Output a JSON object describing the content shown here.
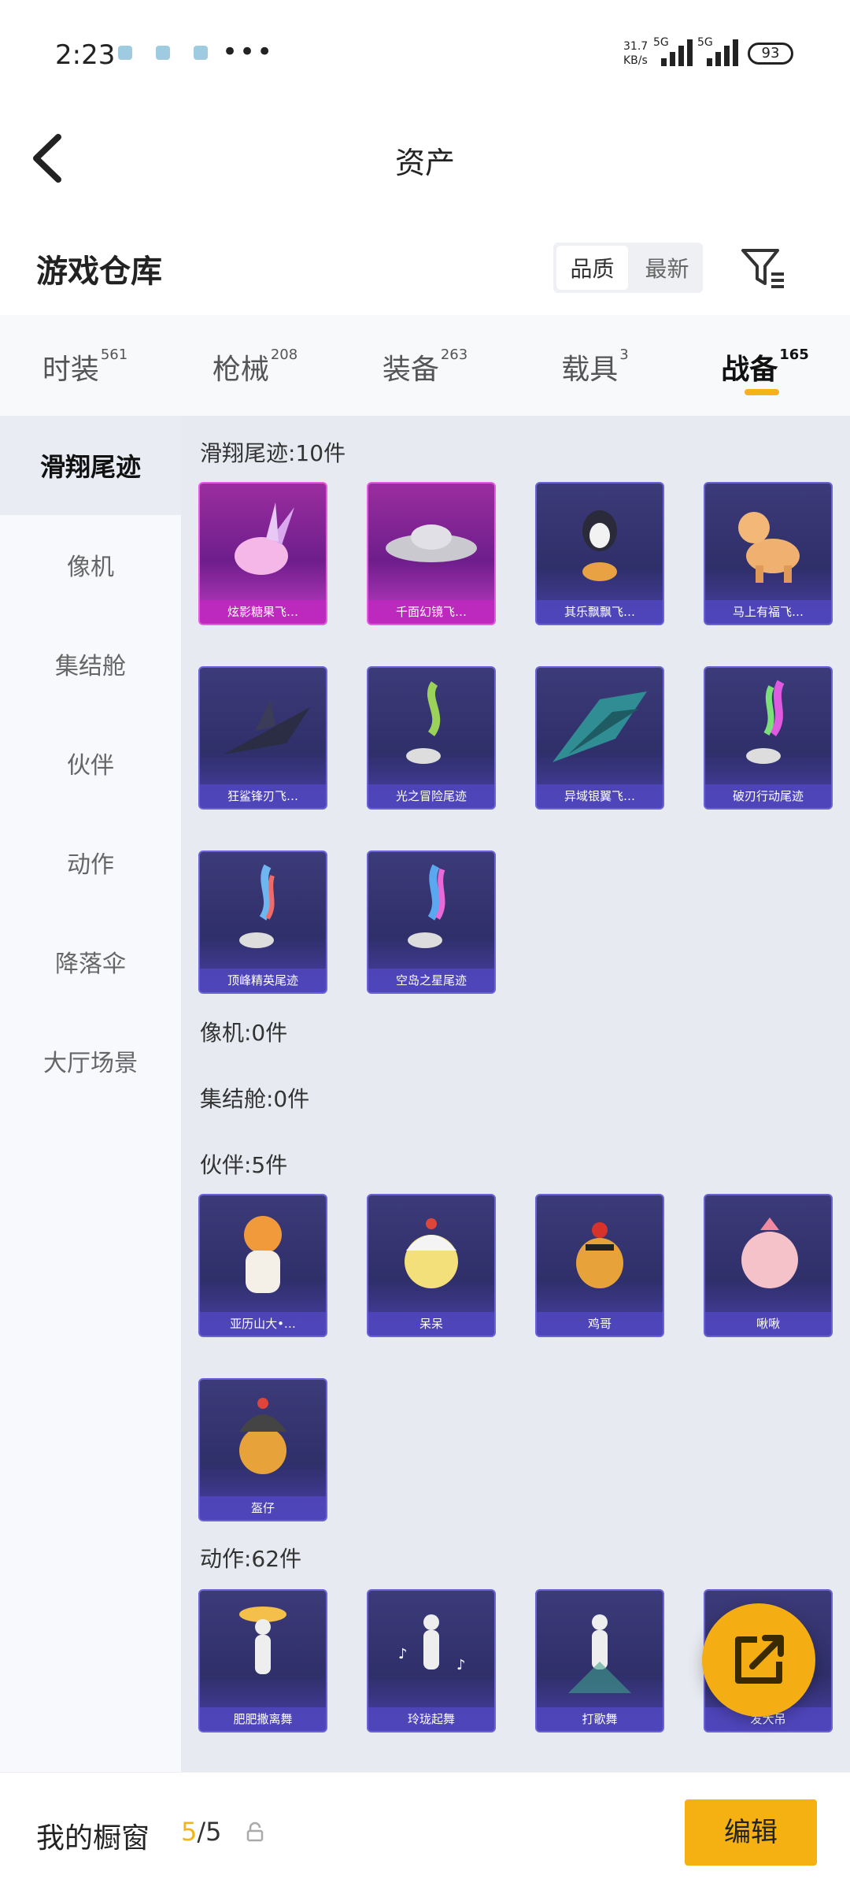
{
  "status": {
    "time": "2:23",
    "more": "•••",
    "net_speed": "31.7",
    "net_unit": "KB/s",
    "sig1": "5G",
    "sig2": "5G",
    "battery": "93"
  },
  "header": {
    "title": "资产"
  },
  "warehouse": {
    "title": "游戏仓库",
    "seg": [
      "品质",
      "最新"
    ]
  },
  "tabs": [
    {
      "label": "时装",
      "count": "561"
    },
    {
      "label": "枪械",
      "count": "208"
    },
    {
      "label": "装备",
      "count": "263"
    },
    {
      "label": "载具",
      "count": "3"
    },
    {
      "label": "战备",
      "count": "165"
    }
  ],
  "sidebar": [
    "滑翔尾迹",
    "像机",
    "集结舱",
    "伙伴",
    "动作",
    "降落伞",
    "大厅场景"
  ],
  "sections": {
    "glide": "滑翔尾迹:10件",
    "camera": "像机:0件",
    "capsule": "集结舱:0件",
    "partner": "伙伴:5件",
    "action": "动作:62件"
  },
  "glide_items": [
    "炫影糖果飞…",
    "千面幻镜飞…",
    "其乐飘飘飞…",
    "马上有福飞…",
    "狂鲨锋刃飞…",
    "光之冒险尾迹",
    "异域银翼飞…",
    "破刃行动尾迹",
    "顶峰精英尾迹",
    "空岛之星尾迹"
  ],
  "partner_items": [
    "亚历山大•…",
    "呆呆",
    "鸡哥",
    "啾啾",
    "盔仔"
  ],
  "action_items": [
    "肥肥撒离舞",
    "玲珑起舞",
    "打歌舞",
    "发大吊"
  ],
  "bottom": {
    "label": "我的橱窗",
    "count_used": "5",
    "count_total": "/5",
    "edit": "编辑"
  },
  "colors": {
    "accent": "#f3b31a",
    "card_blue": "#3c3b79",
    "card_pink": "#9b2d9f"
  }
}
